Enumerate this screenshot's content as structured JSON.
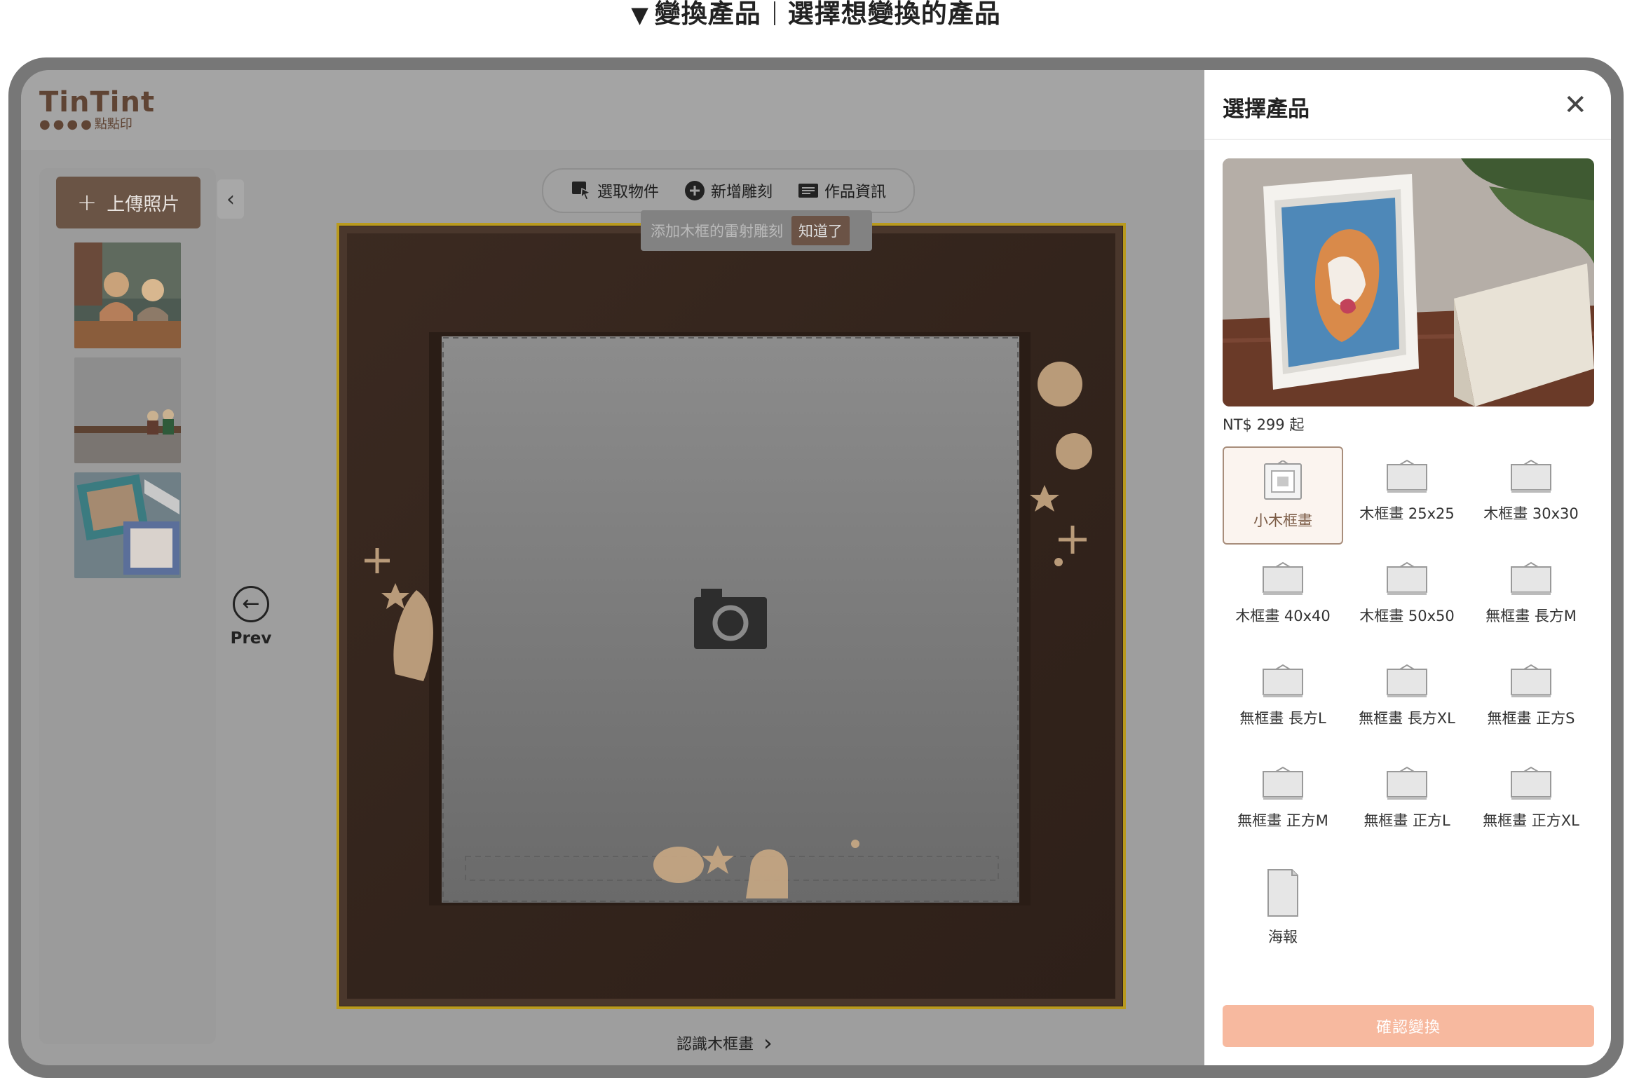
{
  "caption": {
    "marker": "▼",
    "left": "變換產品",
    "right": "選擇想變換的產品"
  },
  "logo": {
    "word": "TinTint",
    "dots": "●●●●",
    "sub": "點點印"
  },
  "sidebar": {
    "upload_label": "上傳照片",
    "collapse_icon": "chevron-left-icon"
  },
  "toolbar": {
    "select_label": "選取物件",
    "engrave_label": "新增雕刻",
    "info_label": "作品資訊"
  },
  "tooltip": {
    "text": "添加木框的雷射雕刻",
    "ok_label": "知道了"
  },
  "nav": {
    "prev_label": "Prev",
    "learn_label": "認識木框畫"
  },
  "drawer": {
    "title": "選擇產品",
    "price": "NT$ 299 起",
    "products": [
      {
        "label": "小木框畫",
        "selected": true
      },
      {
        "label": "木框畫 25x25"
      },
      {
        "label": "木框畫 30x30"
      },
      {
        "label": "木框畫 40x40"
      },
      {
        "label": "木框畫 50x50"
      },
      {
        "label": "無框畫 長方M"
      },
      {
        "label": "無框畫 長方L"
      },
      {
        "label": "無框畫 長方XL"
      },
      {
        "label": "無框畫 正方S"
      },
      {
        "label": "無框畫 正方M"
      },
      {
        "label": "無框畫 正方L"
      },
      {
        "label": "無框畫 正方XL"
      },
      {
        "label": "海報"
      }
    ],
    "confirm_label": "確認變換"
  },
  "colors": {
    "accent_brown": "#6a5445",
    "confirm_peach": "#f7b99f",
    "frame_gold": "#b99a1e"
  }
}
